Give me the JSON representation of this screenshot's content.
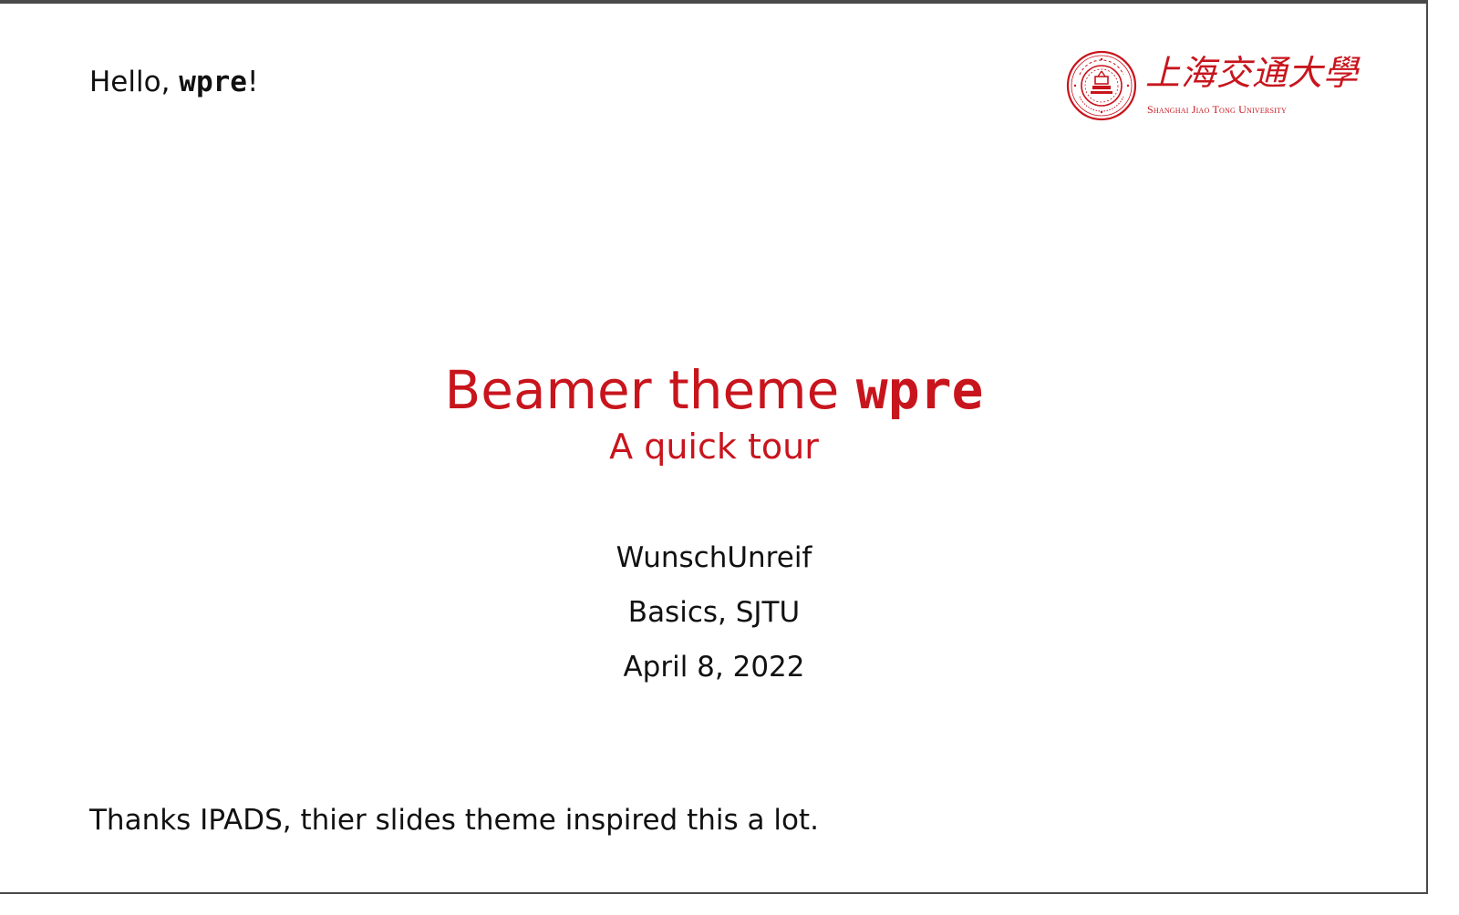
{
  "colors": {
    "accent": "#c8151d",
    "text": "#111111"
  },
  "header": {
    "greeting_prefix": "Hello, ",
    "greeting_code": "wpre",
    "greeting_suffix": "!"
  },
  "logo": {
    "cn_name": "上海交通大學",
    "en_name": "Shanghai Jiao Tong University",
    "seal_icon": "sjtu-seal-icon"
  },
  "title": {
    "main_prefix": "Beamer theme ",
    "main_code": "wpre",
    "subtitle": "A quick tour"
  },
  "meta": {
    "author": "WunschUnreif",
    "institute": "Basics, SJTU",
    "date": "April 8, 2022"
  },
  "footer": {
    "note": "Thanks IPADS, thier slides theme inspired this a lot."
  }
}
